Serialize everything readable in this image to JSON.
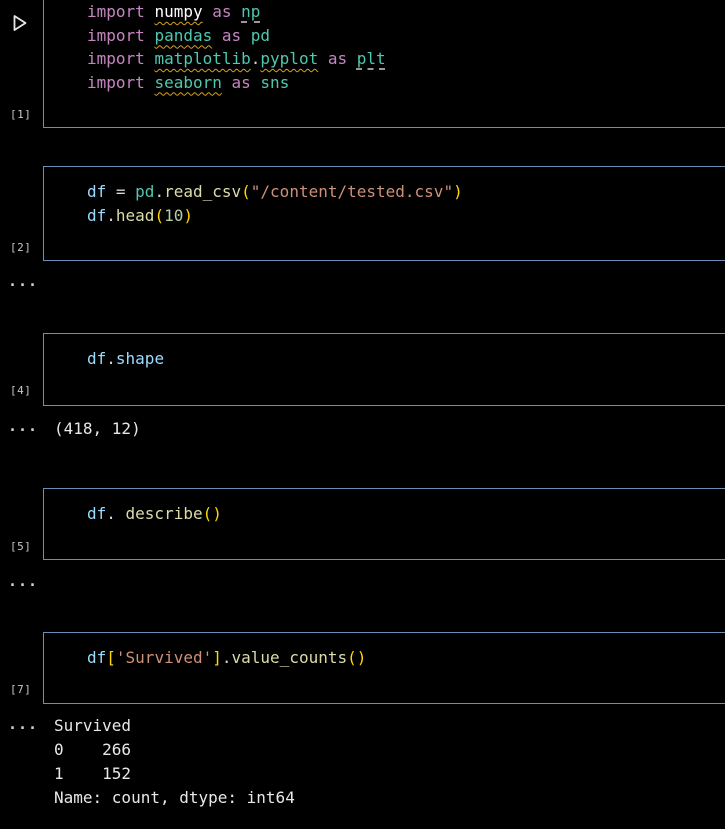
{
  "cells": [
    {
      "count": "[1]",
      "lines": [
        [
          {
            "t": "import",
            "c": "kw"
          },
          {
            "t": " "
          },
          {
            "t": "numpy",
            "c": "white squig"
          },
          {
            "t": " "
          },
          {
            "t": "as",
            "c": "kw"
          },
          {
            "t": " "
          },
          {
            "t": "np",
            "c": "mod dash"
          }
        ],
        [
          {
            "t": "import",
            "c": "kw"
          },
          {
            "t": " "
          },
          {
            "t": "pandas",
            "c": "mod squig"
          },
          {
            "t": " "
          },
          {
            "t": "as",
            "c": "kw"
          },
          {
            "t": " "
          },
          {
            "t": "pd",
            "c": "mod"
          }
        ],
        [
          {
            "t": "import",
            "c": "kw"
          },
          {
            "t": " "
          },
          {
            "t": "matplotlib",
            "c": "mod squig"
          },
          {
            "t": ".",
            "c": "op"
          },
          {
            "t": "pyplot",
            "c": "mod squig"
          },
          {
            "t": " "
          },
          {
            "t": "as",
            "c": "kw"
          },
          {
            "t": " "
          },
          {
            "t": "plt",
            "c": "mod dash"
          }
        ],
        [
          {
            "t": "import",
            "c": "kw"
          },
          {
            "t": " "
          },
          {
            "t": "seaborn",
            "c": "mod squig"
          },
          {
            "t": " "
          },
          {
            "t": "as",
            "c": "kw"
          },
          {
            "t": " "
          },
          {
            "t": "sns",
            "c": "mod"
          }
        ]
      ],
      "output": null,
      "collapsed_output": false
    },
    {
      "count": "[2]",
      "lines": [
        [
          {
            "t": "df",
            "c": "plain"
          },
          {
            "t": " = ",
            "c": "op"
          },
          {
            "t": "pd",
            "c": "mod"
          },
          {
            "t": ".",
            "c": "op"
          },
          {
            "t": "read_csv",
            "c": "fn"
          },
          {
            "t": "(",
            "c": "paren"
          },
          {
            "t": "\"/content/tested.csv\"",
            "c": "str"
          },
          {
            "t": ")",
            "c": "paren"
          }
        ],
        [
          {
            "t": "df",
            "c": "plain"
          },
          {
            "t": ".",
            "c": "op"
          },
          {
            "t": "head",
            "c": "fn"
          },
          {
            "t": "(",
            "c": "paren"
          },
          {
            "t": "10",
            "c": "num"
          },
          {
            "t": ")",
            "c": "paren"
          }
        ]
      ],
      "output": null,
      "collapsed_output": true
    },
    {
      "count": "[4]",
      "lines": [
        [
          {
            "t": "df",
            "c": "plain"
          },
          {
            "t": ".",
            "c": "op"
          },
          {
            "t": "shape",
            "c": "plain"
          }
        ]
      ],
      "output": "(418, 12)",
      "collapsed_output": false
    },
    {
      "count": "[5]",
      "lines": [
        [
          {
            "t": "df",
            "c": "plain"
          },
          {
            "t": ". ",
            "c": "op"
          },
          {
            "t": "describe",
            "c": "fn"
          },
          {
            "t": "()",
            "c": "paren"
          }
        ]
      ],
      "output": null,
      "collapsed_output": true
    },
    {
      "count": "[7]",
      "lines": [
        [
          {
            "t": "df",
            "c": "plain"
          },
          {
            "t": "[",
            "c": "paren"
          },
          {
            "t": "'Survived'",
            "c": "str"
          },
          {
            "t": "]",
            "c": "paren"
          },
          {
            "t": ".",
            "c": "op"
          },
          {
            "t": "value_counts",
            "c": "fn"
          },
          {
            "t": "()",
            "c": "paren"
          }
        ]
      ],
      "output": "Survived\n0    266\n1    152\nName: count, dtype: int64",
      "collapsed_output": false
    }
  ],
  "ellipsis_label": "..."
}
